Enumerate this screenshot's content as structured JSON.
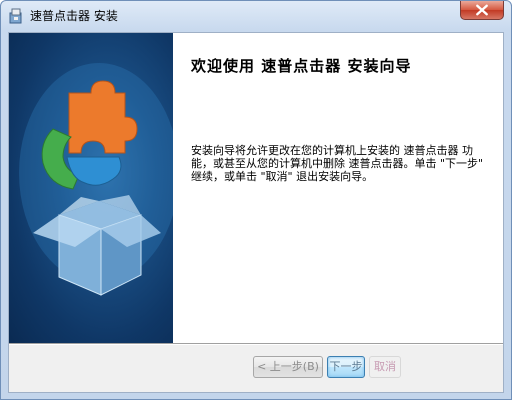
{
  "window": {
    "title": "速普点击器 安装"
  },
  "welcome": {
    "title": "欢迎使用  速普点击器  安装向导",
    "body": "安装向导将允许更改在您的计算机上安装的 速普点击器 功能，或甚至从您的计算机中删除 速普点击器。单击 \"下一步\" 继续，或单击 \"取消\" 退出安装向导。"
  },
  "buttons": {
    "back": "< 上一步(B)",
    "next": "下一步",
    "cancel": "取消"
  },
  "icons": {
    "app": "installer-icon",
    "close": "close-icon",
    "banner": "puzzle-box-icon"
  },
  "colors": {
    "banner": "#1a4f85",
    "close": "#c23a24",
    "accent_orange": "#e8742a",
    "accent_green": "#3aa34a",
    "accent_blue": "#2b86c8"
  }
}
